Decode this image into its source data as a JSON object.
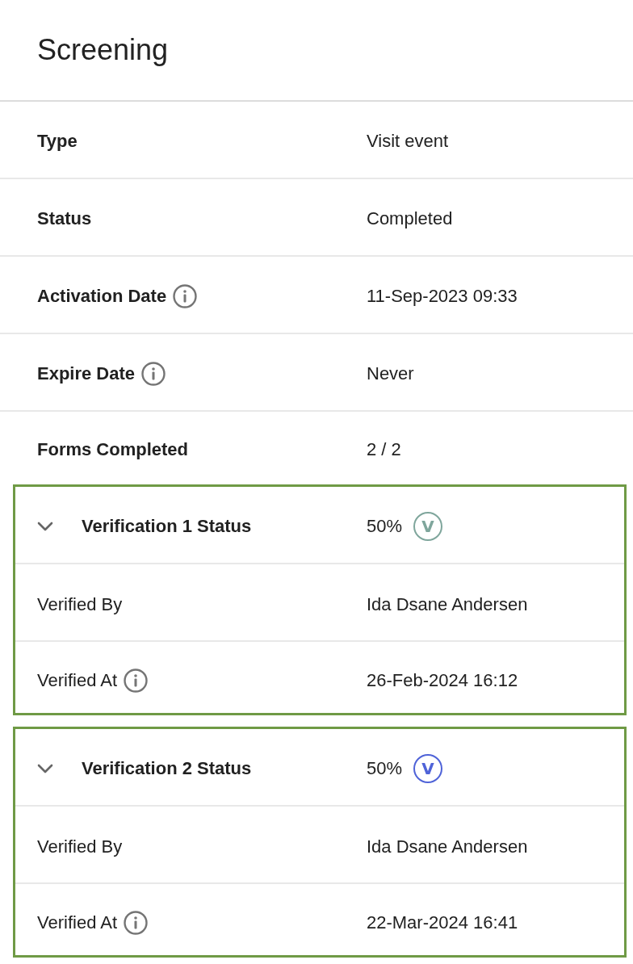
{
  "header": {
    "title": "Screening"
  },
  "details": [
    {
      "label": "Type",
      "value": "Visit event",
      "info": false
    },
    {
      "label": "Status",
      "value": "Completed",
      "info": false
    },
    {
      "label": "Activation Date",
      "value": "11-Sep-2023 09:33",
      "info": true
    },
    {
      "label": "Expire Date",
      "value": "Never",
      "info": true
    },
    {
      "label": "Forms Completed",
      "value": "2 / 2",
      "info": false
    }
  ],
  "verifications": [
    {
      "label": "Verification 1 Status",
      "expanded": true,
      "value": "50%",
      "badge": "V",
      "color": "#7fa69c",
      "rows": [
        {
          "label": "Verified By",
          "value": "Ida Dsane Andersen",
          "info": false
        },
        {
          "label": "Verified At",
          "value": "26-Feb-2024 16:12",
          "info": true
        }
      ]
    },
    {
      "label": "Verification 2 Status",
      "expanded": true,
      "value": "50%",
      "badge": "V",
      "color": "#4f63d8",
      "rows": [
        {
          "label": "Verified By",
          "value": "Ida Dsane Andersen",
          "info": false
        },
        {
          "label": "Verified At",
          "value": "22-Mar-2024 16:41",
          "info": true
        }
      ]
    }
  ]
}
